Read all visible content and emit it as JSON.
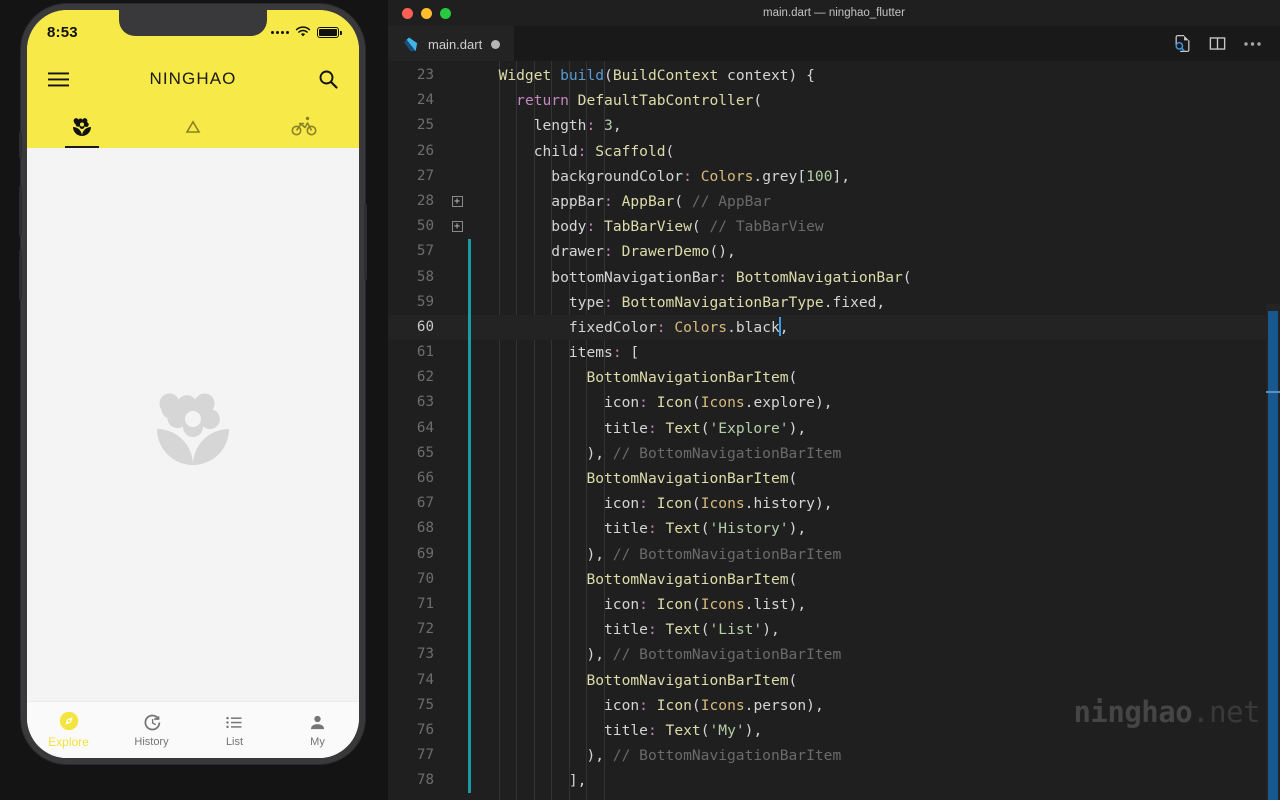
{
  "window": {
    "title": "main.dart — ninghao_flutter",
    "traffic_lights": [
      {
        "name": "close",
        "color": "#ff5f57"
      },
      {
        "name": "minimize",
        "color": "#febc2e"
      },
      {
        "name": "maximize",
        "color": "#28c840"
      }
    ]
  },
  "editor": {
    "tab": {
      "filename": "main.dart",
      "icon": "dart-logo-icon",
      "dirty": true
    },
    "actions": [
      {
        "name": "find-in-file-icon",
        "label": "Find"
      },
      {
        "name": "split-editor-icon",
        "label": "Split Editor"
      },
      {
        "name": "more-actions-icon",
        "label": "More Actions..."
      }
    ],
    "watermark": {
      "bold": "ninghao",
      "light": ".net"
    },
    "lines": [
      {
        "n": "23",
        "indent": 1,
        "fold": "",
        "mod": false,
        "active": false,
        "tokens": [
          [
            "t-type",
            "Widget"
          ],
          [
            "t-pl",
            " "
          ],
          [
            "t-fn",
            "build"
          ],
          [
            "t-pl",
            "("
          ],
          [
            "t-type",
            "BuildContext"
          ],
          [
            "t-pl",
            " context) {"
          ]
        ]
      },
      {
        "n": "24",
        "indent": 2,
        "fold": "",
        "mod": false,
        "active": false,
        "tokens": [
          [
            "t-kw",
            "return"
          ],
          [
            "t-pl",
            " "
          ],
          [
            "t-type",
            "DefaultTabController"
          ],
          [
            "t-pl",
            "("
          ]
        ]
      },
      {
        "n": "25",
        "indent": 3,
        "fold": "",
        "mod": false,
        "active": false,
        "tokens": [
          [
            "t-pl",
            "length"
          ],
          [
            "t-op",
            ":"
          ],
          [
            "t-pl",
            " "
          ],
          [
            "t-num",
            "3"
          ],
          [
            "t-pl",
            ","
          ]
        ]
      },
      {
        "n": "26",
        "indent": 3,
        "fold": "",
        "mod": false,
        "active": false,
        "tokens": [
          [
            "t-pl",
            "child"
          ],
          [
            "t-op",
            ":"
          ],
          [
            "t-pl",
            " "
          ],
          [
            "t-type",
            "Scaffold"
          ],
          [
            "t-pl",
            "("
          ]
        ]
      },
      {
        "n": "27",
        "indent": 4,
        "fold": "",
        "mod": false,
        "active": false,
        "tokens": [
          [
            "t-pl",
            "backgroundColor"
          ],
          [
            "t-op",
            ":"
          ],
          [
            "t-pl",
            " "
          ],
          [
            "t-cls",
            "Colors"
          ],
          [
            "t-pl",
            ".grey["
          ],
          [
            "t-num",
            "100"
          ],
          [
            "t-pl",
            "],"
          ]
        ]
      },
      {
        "n": "28",
        "indent": 4,
        "fold": "+",
        "mod": false,
        "active": false,
        "tokens": [
          [
            "t-pl",
            "appBar"
          ],
          [
            "t-op",
            ":"
          ],
          [
            "t-pl",
            " "
          ],
          [
            "t-type",
            "AppBar"
          ],
          [
            "t-pl",
            "( "
          ],
          [
            "t-cmt",
            "// AppBar"
          ]
        ]
      },
      {
        "n": "50",
        "indent": 4,
        "fold": "+",
        "mod": false,
        "active": false,
        "tokens": [
          [
            "t-pl",
            "body"
          ],
          [
            "t-op",
            ":"
          ],
          [
            "t-pl",
            " "
          ],
          [
            "t-type",
            "TabBarView"
          ],
          [
            "t-pl",
            "( "
          ],
          [
            "t-cmt",
            "// TabBarView"
          ]
        ]
      },
      {
        "n": "57",
        "indent": 4,
        "fold": "",
        "mod": true,
        "active": false,
        "tokens": [
          [
            "t-pl",
            "drawer"
          ],
          [
            "t-op",
            ":"
          ],
          [
            "t-pl",
            " "
          ],
          [
            "t-type",
            "DrawerDemo"
          ],
          [
            "t-pl",
            "(),"
          ]
        ]
      },
      {
        "n": "58",
        "indent": 4,
        "fold": "",
        "mod": true,
        "active": false,
        "tokens": [
          [
            "t-pl",
            "bottomNavigationBar"
          ],
          [
            "t-op",
            ":"
          ],
          [
            "t-pl",
            " "
          ],
          [
            "t-type",
            "BottomNavigationBar"
          ],
          [
            "t-pl",
            "("
          ]
        ]
      },
      {
        "n": "59",
        "indent": 5,
        "fold": "",
        "mod": true,
        "active": false,
        "tokens": [
          [
            "t-pl",
            "type"
          ],
          [
            "t-op",
            ":"
          ],
          [
            "t-pl",
            " "
          ],
          [
            "t-type",
            "BottomNavigationBarType"
          ],
          [
            "t-pl",
            ".fixed,"
          ]
        ]
      },
      {
        "n": "60",
        "indent": 5,
        "fold": "",
        "mod": true,
        "active": true,
        "tokens": [
          [
            "t-pl",
            "fixedColor"
          ],
          [
            "t-op",
            ":"
          ],
          [
            "t-pl",
            " "
          ],
          [
            "t-cls",
            "Colors"
          ],
          [
            "t-pl",
            ".black"
          ],
          [
            "cursor",
            ""
          ],
          [
            "t-pl",
            ","
          ]
        ]
      },
      {
        "n": "61",
        "indent": 5,
        "fold": "",
        "mod": true,
        "active": false,
        "tokens": [
          [
            "t-pl",
            "items"
          ],
          [
            "t-op",
            ":"
          ],
          [
            "t-pl",
            " ["
          ]
        ]
      },
      {
        "n": "62",
        "indent": 6,
        "fold": "",
        "mod": true,
        "active": false,
        "tokens": [
          [
            "t-type",
            "BottomNavigationBarItem"
          ],
          [
            "t-pl",
            "("
          ]
        ]
      },
      {
        "n": "63",
        "indent": 7,
        "fold": "",
        "mod": true,
        "active": false,
        "tokens": [
          [
            "t-pl",
            "icon"
          ],
          [
            "t-op",
            ":"
          ],
          [
            "t-pl",
            " "
          ],
          [
            "t-type",
            "Icon"
          ],
          [
            "t-pl",
            "("
          ],
          [
            "t-cls",
            "Icons"
          ],
          [
            "t-pl",
            ".explore),"
          ]
        ]
      },
      {
        "n": "64",
        "indent": 7,
        "fold": "",
        "mod": true,
        "active": false,
        "tokens": [
          [
            "t-pl",
            "title"
          ],
          [
            "t-op",
            ":"
          ],
          [
            "t-pl",
            " "
          ],
          [
            "t-type",
            "Text"
          ],
          [
            "t-pl",
            "("
          ],
          [
            "t-str",
            "'Explore'"
          ],
          [
            "t-pl",
            "),"
          ]
        ]
      },
      {
        "n": "65",
        "indent": 6,
        "fold": "",
        "mod": true,
        "active": false,
        "tokens": [
          [
            "t-pl",
            "), "
          ],
          [
            "t-cmt",
            "// BottomNavigationBarItem"
          ]
        ]
      },
      {
        "n": "66",
        "indent": 6,
        "fold": "",
        "mod": true,
        "active": false,
        "tokens": [
          [
            "t-type",
            "BottomNavigationBarItem"
          ],
          [
            "t-pl",
            "("
          ]
        ]
      },
      {
        "n": "67",
        "indent": 7,
        "fold": "",
        "mod": true,
        "active": false,
        "tokens": [
          [
            "t-pl",
            "icon"
          ],
          [
            "t-op",
            ":"
          ],
          [
            "t-pl",
            " "
          ],
          [
            "t-type",
            "Icon"
          ],
          [
            "t-pl",
            "("
          ],
          [
            "t-cls",
            "Icons"
          ],
          [
            "t-pl",
            ".history),"
          ]
        ]
      },
      {
        "n": "68",
        "indent": 7,
        "fold": "",
        "mod": true,
        "active": false,
        "tokens": [
          [
            "t-pl",
            "title"
          ],
          [
            "t-op",
            ":"
          ],
          [
            "t-pl",
            " "
          ],
          [
            "t-type",
            "Text"
          ],
          [
            "t-pl",
            "("
          ],
          [
            "t-str",
            "'History'"
          ],
          [
            "t-pl",
            "),"
          ]
        ]
      },
      {
        "n": "69",
        "indent": 6,
        "fold": "",
        "mod": true,
        "active": false,
        "tokens": [
          [
            "t-pl",
            "), "
          ],
          [
            "t-cmt",
            "// BottomNavigationBarItem"
          ]
        ]
      },
      {
        "n": "70",
        "indent": 6,
        "fold": "",
        "mod": true,
        "active": false,
        "tokens": [
          [
            "t-type",
            "BottomNavigationBarItem"
          ],
          [
            "t-pl",
            "("
          ]
        ]
      },
      {
        "n": "71",
        "indent": 7,
        "fold": "",
        "mod": true,
        "active": false,
        "tokens": [
          [
            "t-pl",
            "icon"
          ],
          [
            "t-op",
            ":"
          ],
          [
            "t-pl",
            " "
          ],
          [
            "t-type",
            "Icon"
          ],
          [
            "t-pl",
            "("
          ],
          [
            "t-cls",
            "Icons"
          ],
          [
            "t-pl",
            ".list),"
          ]
        ]
      },
      {
        "n": "72",
        "indent": 7,
        "fold": "",
        "mod": true,
        "active": false,
        "tokens": [
          [
            "t-pl",
            "title"
          ],
          [
            "t-op",
            ":"
          ],
          [
            "t-pl",
            " "
          ],
          [
            "t-type",
            "Text"
          ],
          [
            "t-pl",
            "("
          ],
          [
            "t-str",
            "'List'"
          ],
          [
            "t-pl",
            "),"
          ]
        ]
      },
      {
        "n": "73",
        "indent": 6,
        "fold": "",
        "mod": true,
        "active": false,
        "tokens": [
          [
            "t-pl",
            "), "
          ],
          [
            "t-cmt",
            "// BottomNavigationBarItem"
          ]
        ]
      },
      {
        "n": "74",
        "indent": 6,
        "fold": "",
        "mod": true,
        "active": false,
        "tokens": [
          [
            "t-type",
            "BottomNavigationBarItem"
          ],
          [
            "t-pl",
            "("
          ]
        ]
      },
      {
        "n": "75",
        "indent": 7,
        "fold": "",
        "mod": true,
        "active": false,
        "tokens": [
          [
            "t-pl",
            "icon"
          ],
          [
            "t-op",
            ":"
          ],
          [
            "t-pl",
            " "
          ],
          [
            "t-type",
            "Icon"
          ],
          [
            "t-pl",
            "("
          ],
          [
            "t-cls",
            "Icons"
          ],
          [
            "t-pl",
            ".person),"
          ]
        ]
      },
      {
        "n": "76",
        "indent": 7,
        "fold": "",
        "mod": true,
        "active": false,
        "tokens": [
          [
            "t-pl",
            "title"
          ],
          [
            "t-op",
            ":"
          ],
          [
            "t-pl",
            " "
          ],
          [
            "t-type",
            "Text"
          ],
          [
            "t-pl",
            "("
          ],
          [
            "t-str",
            "'My'"
          ],
          [
            "t-pl",
            "),"
          ]
        ]
      },
      {
        "n": "77",
        "indent": 6,
        "fold": "",
        "mod": true,
        "active": false,
        "tokens": [
          [
            "t-pl",
            "), "
          ],
          [
            "t-cmt",
            "// BottomNavigationBarItem"
          ]
        ]
      },
      {
        "n": "78",
        "indent": 5,
        "fold": "",
        "mod": true,
        "active": false,
        "tokens": [
          [
            "t-pl",
            "],"
          ]
        ]
      }
    ]
  },
  "simulator": {
    "status_bar": {
      "time": "8:53",
      "wifi_icon": "wifi-icon",
      "battery_icon": "battery-icon",
      "signal_icon": "signal-dots-icon"
    },
    "app_bar": {
      "menu_icon": "hamburger-menu-icon",
      "title": "NINGHAO",
      "search_icon": "search-icon"
    },
    "tabs": [
      {
        "icon": "local-florist-icon",
        "active": true
      },
      {
        "icon": "change-history-icon",
        "active": false
      },
      {
        "icon": "directions-bike-icon",
        "active": false
      }
    ],
    "body": {
      "placeholder_icon": "flower-placeholder-icon"
    },
    "bottom_nav": [
      {
        "icon": "explore-icon",
        "label": "Explore",
        "active": true
      },
      {
        "icon": "history-icon",
        "label": "History",
        "active": false
      },
      {
        "icon": "list-icon",
        "label": "List",
        "active": false
      },
      {
        "icon": "person-icon",
        "label": "My",
        "active": false
      }
    ],
    "colors": {
      "accent": "#f7ea48",
      "body_bg": "#f4f4f4",
      "nav_bg": "#fafafa"
    }
  }
}
